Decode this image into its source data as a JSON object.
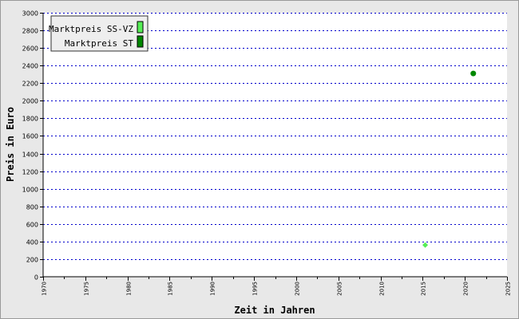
{
  "chart_data": {
    "type": "scatter",
    "title": "",
    "xlabel": "Zeit in Jahren",
    "ylabel": "Preis in Euro",
    "xlim": [
      1970,
      2025
    ],
    "ylim": [
      0,
      3000
    ],
    "x_ticks": [
      "1970",
      "1975",
      "1980",
      "1985",
      "1990",
      "1995",
      "2000",
      "2005",
      "2010",
      "2015",
      "2020",
      "2025"
    ],
    "y_ticks": [
      "0",
      "200",
      "400",
      "600",
      "800",
      "1000",
      "1200",
      "1400",
      "1600",
      "1800",
      "2000",
      "2200",
      "2400",
      "2600",
      "2800",
      "3000"
    ],
    "grid": "horizontal dotted",
    "legend_position": "top-left",
    "series": [
      {
        "name": "Marktpreis SS-VZ",
        "color": "#55ee55",
        "marker": "diamond",
        "points": [
          [
            2015.3,
            360
          ]
        ]
      },
      {
        "name": "Marktpreis ST",
        "color": "#008800",
        "marker": "circle",
        "points": [
          [
            2021,
            2310
          ]
        ]
      }
    ]
  }
}
